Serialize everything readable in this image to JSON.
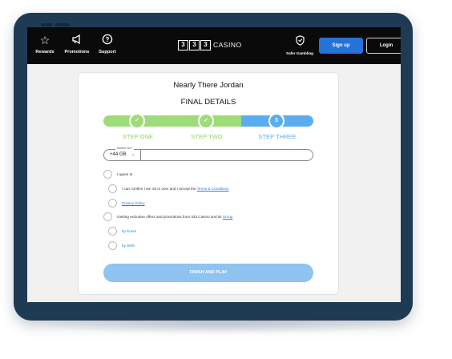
{
  "nav": {
    "items": [
      {
        "label": "Rewards",
        "icon": "star-icon"
      },
      {
        "label": "Promotions",
        "icon": "megaphone-icon"
      },
      {
        "label": "Support",
        "icon": "help-icon"
      }
    ],
    "logo": {
      "digits": [
        "3",
        "3",
        "3"
      ],
      "word": "CASINO"
    },
    "safer_gambling": "Safer Gambling",
    "signup_label": "Sign up",
    "login_label": "Login"
  },
  "form": {
    "title": "Nearly There Jordan",
    "subtitle": "FINAL DETAILS",
    "steps": [
      {
        "label": "STEP ONE",
        "marker": "✓",
        "state": "complete"
      },
      {
        "label": "STEP TWO",
        "marker": "✓",
        "state": "complete"
      },
      {
        "label": "STEP THREE",
        "marker": "3",
        "state": "active"
      }
    ],
    "phone": {
      "floating_label": "Mobile No*",
      "country_code": "+44 GB",
      "value": ""
    },
    "agree_label": "I agree to",
    "age_text": "I can confirm I am 18 or over and I accept the",
    "terms_link": "Terms & Conditions",
    "privacy_link": "Privacy Policy",
    "offers_text": "Getting exclusive offers and promotions from 333 Casino and its",
    "group_link": "Group",
    "by_email": "by Email",
    "by_sms": "by SMS",
    "finish_label": "FINISH AND PLAY"
  },
  "colors": {
    "nav_bg": "#0a0a0a",
    "tablet_frame": "#1f3b53",
    "accent_blue": "#2672d9",
    "step_complete": "#9ddc78",
    "step_active": "#5aaef0",
    "step_label_green": "#8fd36a",
    "step_label_blue": "#5aaef0",
    "finish_button": "#8ec3f2",
    "link": "#2f7ad6"
  }
}
